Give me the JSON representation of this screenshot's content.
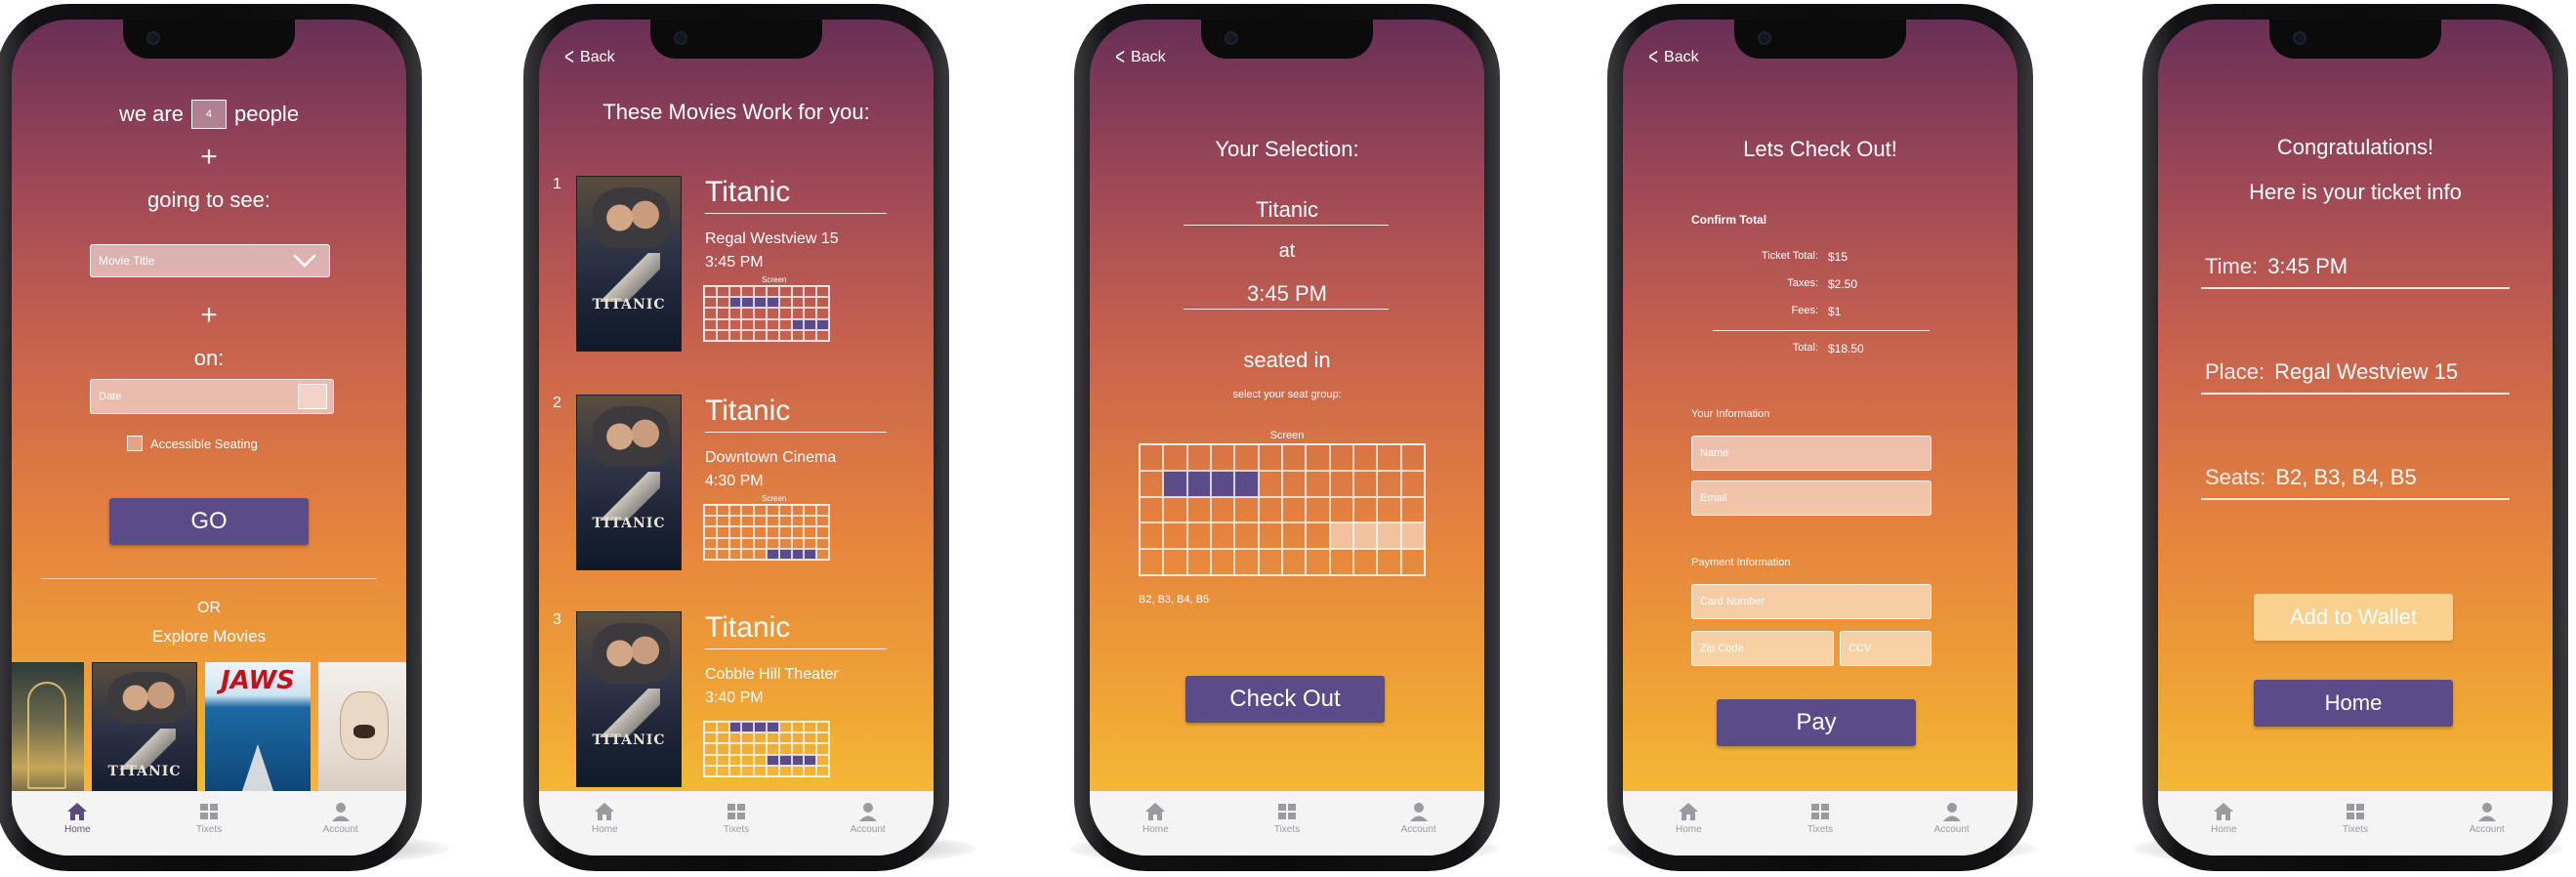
{
  "tabs": [
    {
      "label": "Home",
      "icon": "home-icon"
    },
    {
      "label": "Tixets",
      "icon": "tickets-icon"
    },
    {
      "label": "Account",
      "icon": "account-icon"
    }
  ],
  "back_label": "Back",
  "screen1": {
    "we_are": "we are",
    "people_count": "4",
    "people": "people",
    "plus": "+",
    "going_to_see": "going to see:",
    "movie_title_placeholder": "Movie Title",
    "on": "on:",
    "date_placeholder": "Date",
    "accessible_seating": "Accessible Seating",
    "go": "GO",
    "or": "OR",
    "explore": "Explore Movies",
    "explore_posters": [
      "Metropolis",
      "Titanic",
      "JAWS",
      "The Silence of the Lambs"
    ]
  },
  "screen2": {
    "heading": "These Movies Work for you:",
    "screen_label": "Screen",
    "results": [
      {
        "rank": "1",
        "title": "Titanic",
        "theater": "Regal Westview 15",
        "time": "3:45 PM"
      },
      {
        "rank": "2",
        "title": "Titanic",
        "theater": "Downtown Cinema",
        "time": "4:30 PM"
      },
      {
        "rank": "3",
        "title": "Titanic",
        "theater": "Cobble Hill Theater",
        "time": "3:40 PM"
      }
    ],
    "poster_title": "TITANIC"
  },
  "screen3": {
    "heading": "Your Selection:",
    "movie": "Titanic",
    "at": "at",
    "time": "3:45 PM",
    "seated_in": "seated in",
    "select_seat": "select your seat group:",
    "screen_label": "Screen",
    "seats": "B2, B3, B4, B5",
    "checkout": "Check Out"
  },
  "screen4": {
    "heading": "Lets Check Out!",
    "confirm_total": "Confirm Total",
    "lines": [
      {
        "label": "Ticket Total:",
        "value": "$15"
      },
      {
        "label": "Taxes:",
        "value": "$2.50"
      },
      {
        "label": "Fees:",
        "value": "$1"
      }
    ],
    "total_label": "Total:",
    "total_value": "$18.50",
    "your_info": "Your Information",
    "name_placeholder": "Name",
    "email_placeholder": "Email",
    "payment_info": "Payment Information",
    "card_placeholder": "Card Number",
    "zip_placeholder": "Zip Code",
    "ccv_placeholder": "CCV",
    "pay": "Pay"
  },
  "screen5": {
    "congrats": "Congratulations!",
    "ticket_info": "Here is your ticket info",
    "time_label": "Time:",
    "time_value": "3:45 PM",
    "place_label": "Place:",
    "place_value": "Regal Westview 15",
    "seats_label": "Seats:",
    "seats_value": "B2, B3, B4, B5",
    "wallet": "Add to Wallet",
    "home": "Home"
  },
  "colors": {
    "accent": "#5b4b88",
    "gradient_top": "#682f55",
    "gradient_bottom": "#f6c638"
  }
}
